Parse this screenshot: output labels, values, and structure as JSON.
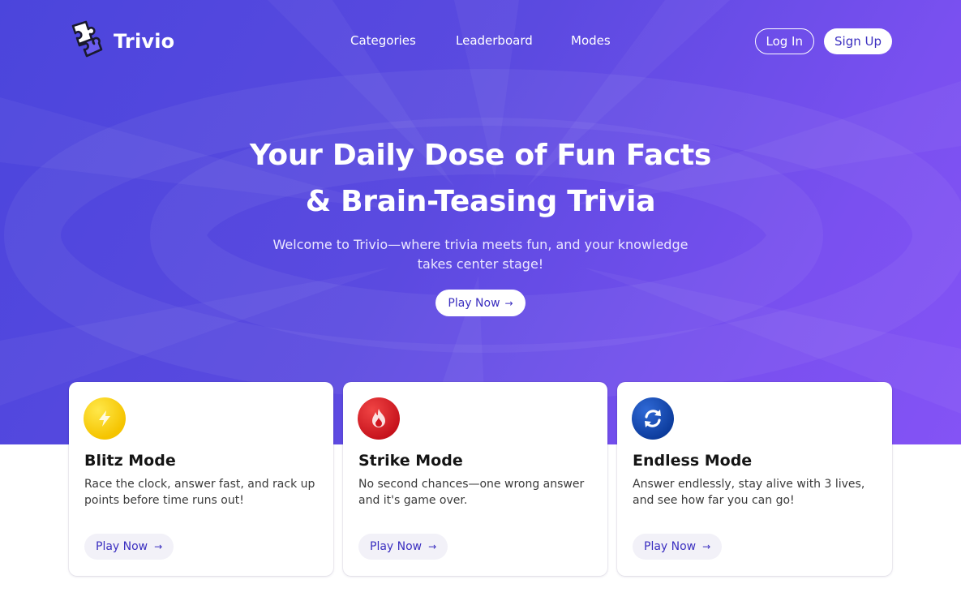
{
  "brand": {
    "name": "Trivio",
    "icon": "puzzle-pieces-icon"
  },
  "nav": {
    "links": [
      "Categories",
      "Leaderboard",
      "Modes"
    ],
    "login_label": "Log In",
    "signup_label": "Sign Up"
  },
  "hero": {
    "title_line1": "Your Daily Dose of Fun Facts",
    "title_line2": "& Brain-Teasing Trivia",
    "subtitle_line1": "Welcome to Trivio—where trivia meets fun, and your knowledge",
    "subtitle_line2": "takes center stage!",
    "cta_label": "Play Now",
    "cta_icon": "arrow-right-icon"
  },
  "modes": [
    {
      "title": "Blitz Mode",
      "description": "Race the clock, answer fast, and rack up points before time runs out!",
      "button_label": "Play Now",
      "icon": "lightning-icon",
      "icon_color": "#f5c400"
    },
    {
      "title": "Strike Mode",
      "description": "No second chances—one wrong answer and it's game over.",
      "button_label": "Play Now",
      "icon": "flame-icon",
      "icon_color": "#d0141f"
    },
    {
      "title": "Endless Mode",
      "description": "Answer endlessly, stay alive with 3 lives, and see how far you can go!",
      "button_label": "Play Now",
      "icon": "cycle-arrows-icon",
      "icon_color": "#0e3f9e"
    }
  ],
  "colors": {
    "hero_gradient_start": "#4b45dc",
    "hero_gradient_end": "#8453f5",
    "accent_text": "#3b2fc0"
  }
}
